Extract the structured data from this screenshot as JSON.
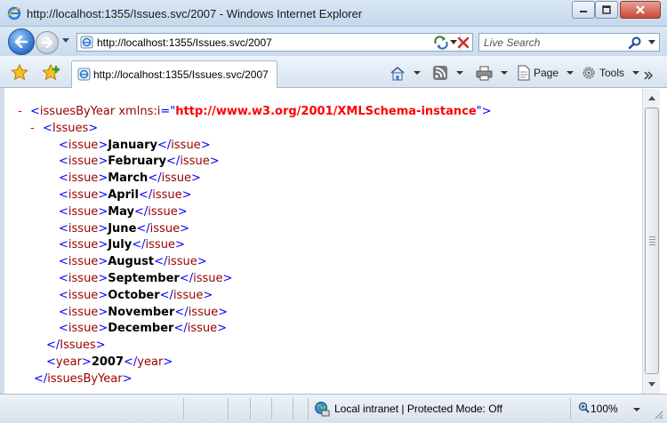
{
  "window": {
    "title": "http://localhost:1355/Issues.svc/2007 - Windows Internet Explorer"
  },
  "navigation": {
    "address": "http://localhost:1355/Issues.svc/2007",
    "search_placeholder": "Live Search"
  },
  "tab": {
    "title": "http://localhost:1355/Issues.svc/2007"
  },
  "toolbar": {
    "page_label": "Page",
    "tools_label": "Tools"
  },
  "document": {
    "minus": "-",
    "root_tag": "issuesByYear",
    "root_attr_name": "xmlns:i",
    "root_attr_value": "http://www.w3.org/2001/XMLSchema-instance",
    "issues_tag": "Issues",
    "issue_tag": "issue",
    "issues": [
      "January",
      "February",
      "March",
      "April",
      "May",
      "June",
      "July",
      "August",
      "September",
      "October",
      "November",
      "December"
    ],
    "year_tag": "year",
    "year_value": "2007"
  },
  "statusbar": {
    "zone": "Local intranet | Protected Mode: Off",
    "zoom": "100%"
  },
  "colors": {
    "xml_markup": "#0000ff",
    "xml_tag": "#990000",
    "xml_attr_value": "#ff0000",
    "chrome_blue": "#c9dbee"
  }
}
